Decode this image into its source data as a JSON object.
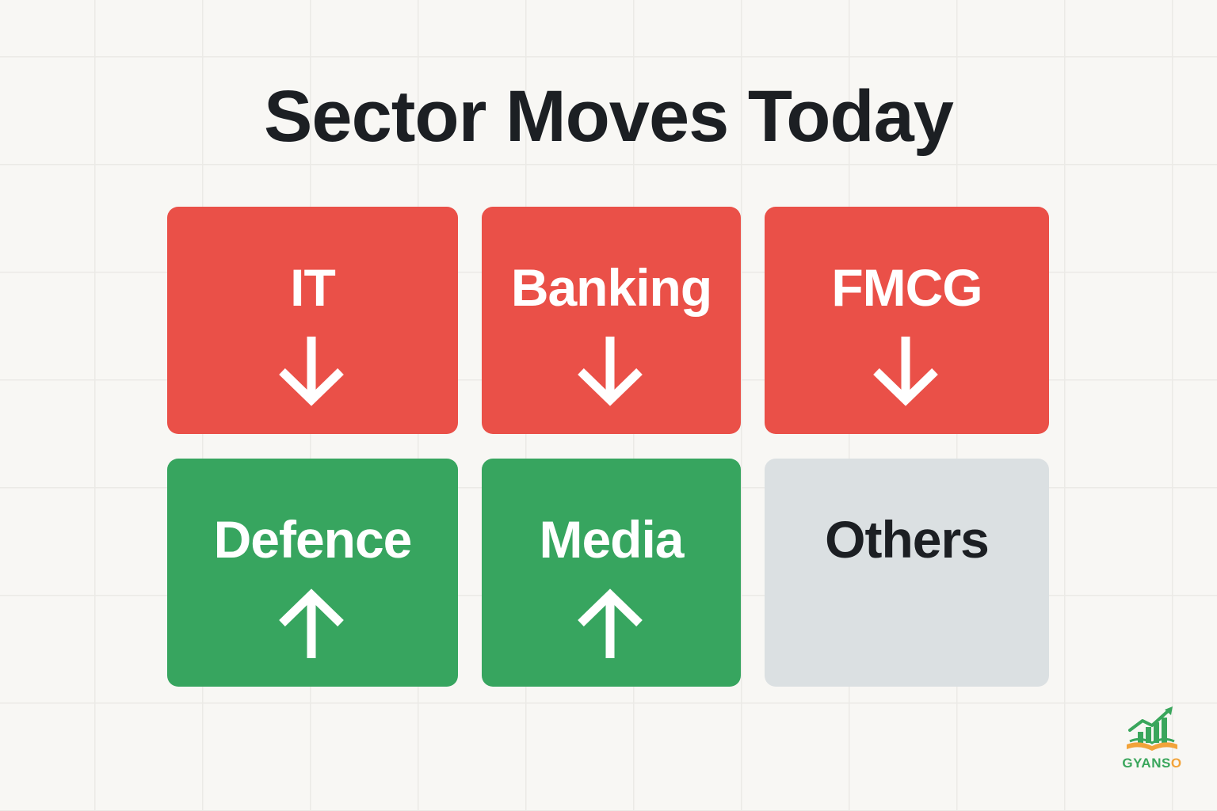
{
  "title": "Sector Moves Today",
  "colors": {
    "down": "#ea5048",
    "up": "#37a55f",
    "neutral": "#dbe0e2",
    "label_light": "#ffffff",
    "label_dark": "#1c1f23"
  },
  "sectors": [
    {
      "name": "IT",
      "direction": "down",
      "icon": "arrow-down-icon"
    },
    {
      "name": "Banking",
      "direction": "down",
      "icon": "arrow-down-icon"
    },
    {
      "name": "FMCG",
      "direction": "down",
      "icon": "arrow-down-icon"
    },
    {
      "name": "Defence",
      "direction": "up",
      "icon": "arrow-up-icon"
    },
    {
      "name": "Media",
      "direction": "up",
      "icon": "arrow-up-icon"
    },
    {
      "name": "Others",
      "direction": "neutral",
      "icon": ""
    }
  ],
  "logo": {
    "text_main": "GYANS",
    "text_accent": "O",
    "icon": "growth-chart-book-icon"
  }
}
